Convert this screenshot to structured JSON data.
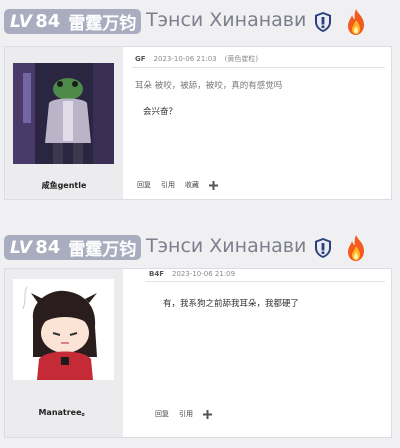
{
  "posts": [
    {
      "header": {
        "level_label": "LV",
        "level_num": "84",
        "level_name": "雷霆万钧",
        "user_title": "Тэнси Хинанави"
      },
      "card": {
        "floor": "GF",
        "date": "2023-10-06 21:03",
        "tag": "(黄色崔粒)",
        "line1": "耳朵 被咬，被舔，被咬，真的有感觉吗",
        "line2": "会兴奋？",
        "username": "咸鱼gentle",
        "actions": [
          "回复",
          "引用",
          "收藏"
        ]
      }
    },
    {
      "header": {
        "level_label": "LV",
        "level_num": "84",
        "level_name": "雷霆万钧",
        "user_title": "Тэнси Хинанави"
      },
      "card": {
        "floor": "B4F",
        "date": "2023-10-06 21:09",
        "line1": "有，我系狗之前舔我耳朵，我都硬了",
        "username": "Manatree。",
        "actions": [
          "回复",
          "引用"
        ]
      }
    }
  ]
}
